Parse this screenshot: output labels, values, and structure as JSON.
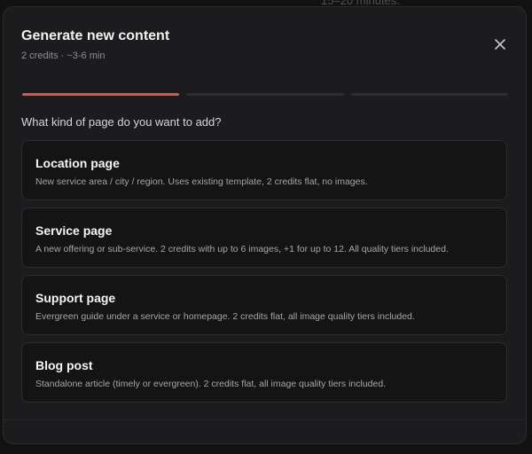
{
  "background": {
    "partial_text": "15–20 minutes."
  },
  "modal": {
    "title": "Generate new content",
    "subtitle": "2 credits · ~3-6 min",
    "close_icon": "close-icon",
    "progress": {
      "total_steps": 3,
      "current_step": 1,
      "active_color": "#e5533c"
    },
    "question": "What kind of page do you want to add?",
    "options": [
      {
        "title": "Location page",
        "description": "New service area / city / region. Uses existing template, 2 credits flat, no images."
      },
      {
        "title": "Service page",
        "description": "A new offering or sub-service. 2 credits with up to 6 images, +1 for up to 12. All quality tiers included."
      },
      {
        "title": "Support page",
        "description": "Evergreen guide under a service or homepage. 2 credits flat, all image quality tiers included."
      },
      {
        "title": "Blog post",
        "description": "Standalone article (timely or evergreen). 2 credits flat, all image quality tiers included."
      }
    ]
  }
}
